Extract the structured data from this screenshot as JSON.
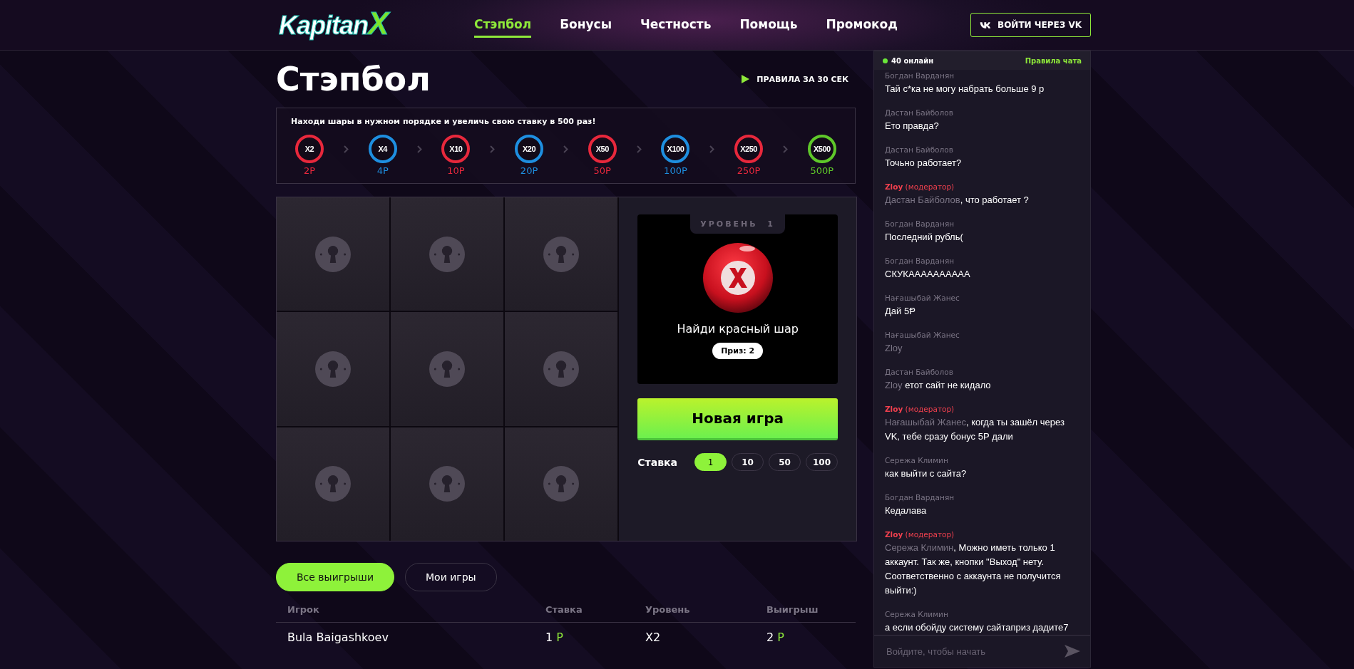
{
  "header": {
    "logo": {
      "text": "Kapitan",
      "accent": "X"
    },
    "nav": [
      {
        "label": "Стэпбол",
        "selected": true
      },
      {
        "label": "Бонусы",
        "selected": false
      },
      {
        "label": "Честность",
        "selected": false
      },
      {
        "label": "Помощь",
        "selected": false
      },
      {
        "label": "Промокод",
        "selected": false
      }
    ],
    "login_button": "ВОЙТИ ЧЕРЕЗ VK"
  },
  "page_title": "Стэпбол",
  "rules_link": "ПРАВИЛА ЗА 30 СЕК",
  "steps": {
    "hint": "Находи шары в нужном порядке и увеличь свою ставку в 500 раз!",
    "items": [
      {
        "multiplier": "X2",
        "reward": "2Р",
        "color": "#e8283c"
      },
      {
        "multiplier": "X4",
        "reward": "4Р",
        "color": "#1e8fe0"
      },
      {
        "multiplier": "X10",
        "reward": "10Р",
        "color": "#e8283c"
      },
      {
        "multiplier": "X20",
        "reward": "20Р",
        "color": "#1e8fe0"
      },
      {
        "multiplier": "X50",
        "reward": "50Р",
        "color": "#e8283c"
      },
      {
        "multiplier": "X100",
        "reward": "100Р",
        "color": "#1e8fe0"
      },
      {
        "multiplier": "X250",
        "reward": "250Р",
        "color": "#e8283c"
      },
      {
        "multiplier": "X500",
        "reward": "500Р",
        "color": "#5fc82a"
      }
    ]
  },
  "grid": {
    "cells": [
      {
        "locked": true
      },
      {
        "locked": true
      },
      {
        "locked": true
      },
      {
        "locked": true
      },
      {
        "locked": true
      },
      {
        "locked": true
      },
      {
        "locked": true
      },
      {
        "locked": true
      },
      {
        "locked": true
      }
    ]
  },
  "game": {
    "level_label": "УРОВЕНЬ",
    "level": "1",
    "task": "Найди красный шар",
    "prize": "Приз: 2",
    "new_game_button": "Новая игра",
    "bet_label": "Ставка",
    "bets": [
      {
        "label": "1",
        "selected": true
      },
      {
        "label": "10",
        "selected": false
      },
      {
        "label": "50",
        "selected": false
      },
      {
        "label": "100",
        "selected": false
      }
    ]
  },
  "history_tabs": [
    {
      "label": "Все выигрыши",
      "selected": true
    },
    {
      "label": "Мои игры",
      "selected": false
    }
  ],
  "table": {
    "columns": [
      "Игрок",
      "Ставка",
      "Уровень",
      "Выигрыш"
    ],
    "rows": [
      {
        "player": "Bula Baigashkoev",
        "bet": {
          "amount": "1",
          "currency": "Р"
        },
        "level": "X2",
        "win": {
          "amount": "2",
          "currency": "Р"
        }
      }
    ]
  },
  "chat": {
    "online": "40 онлайн",
    "rules_link": "Правила чата",
    "messages": [
      {
        "author": "Богдан Варданян",
        "moderator": false,
        "text": "Тай с*ка не могу набрать больше 9 р"
      },
      {
        "author": "Дастан Байболов",
        "moderator": false,
        "text": "Ето правда?"
      },
      {
        "author": "Дастан Байболов",
        "moderator": false,
        "text": "Точьно работает?"
      },
      {
        "author": "Zloy",
        "role": "(модератор)",
        "moderator": true,
        "mention": "Дастан Байболов",
        "text": ", что работает ?"
      },
      {
        "author": "Богдан Варданян",
        "moderator": false,
        "text": "Последний рубль("
      },
      {
        "author": "Богдан Варданян",
        "moderator": false,
        "text": "СКУКАААААААААА"
      },
      {
        "author": "Нағашыбай Жанес",
        "moderator": false,
        "text": "Дай 5Ᵽ"
      },
      {
        "author": "Нағашыбай Жанес",
        "moderator": false,
        "mention": "Zloy"
      },
      {
        "author": "Дастан Байболов",
        "moderator": false,
        "mention": "Zloy",
        "text": " етот сайт не кидало"
      },
      {
        "author": "Zloy",
        "role": "(модератор)",
        "moderator": true,
        "mention": "Нағашыбай Жанес",
        "text": ", когда ты зашёл через VK, тебе сразу бонус 5Р дали"
      },
      {
        "author": "Сережа Климин",
        "moderator": false,
        "text": "как выйти с сайта?"
      },
      {
        "author": "Богдан Варданян",
        "moderator": false,
        "text": "Кедалава"
      },
      {
        "author": "Zloy",
        "role": "(модератор)",
        "moderator": true,
        "mention": "Сережа Климин",
        "text": ", Можно иметь только 1 аккаунт. Так же, кнопки \"Выход\" нету. Соответственно с аккаунта не получится выйти:)"
      },
      {
        "author": "Сережа Климин",
        "moderator": false,
        "text": "а если обойду систему сайтаприз дадите7"
      }
    ],
    "input": {
      "placeholder": "Войдите, чтобы начать"
    }
  }
}
